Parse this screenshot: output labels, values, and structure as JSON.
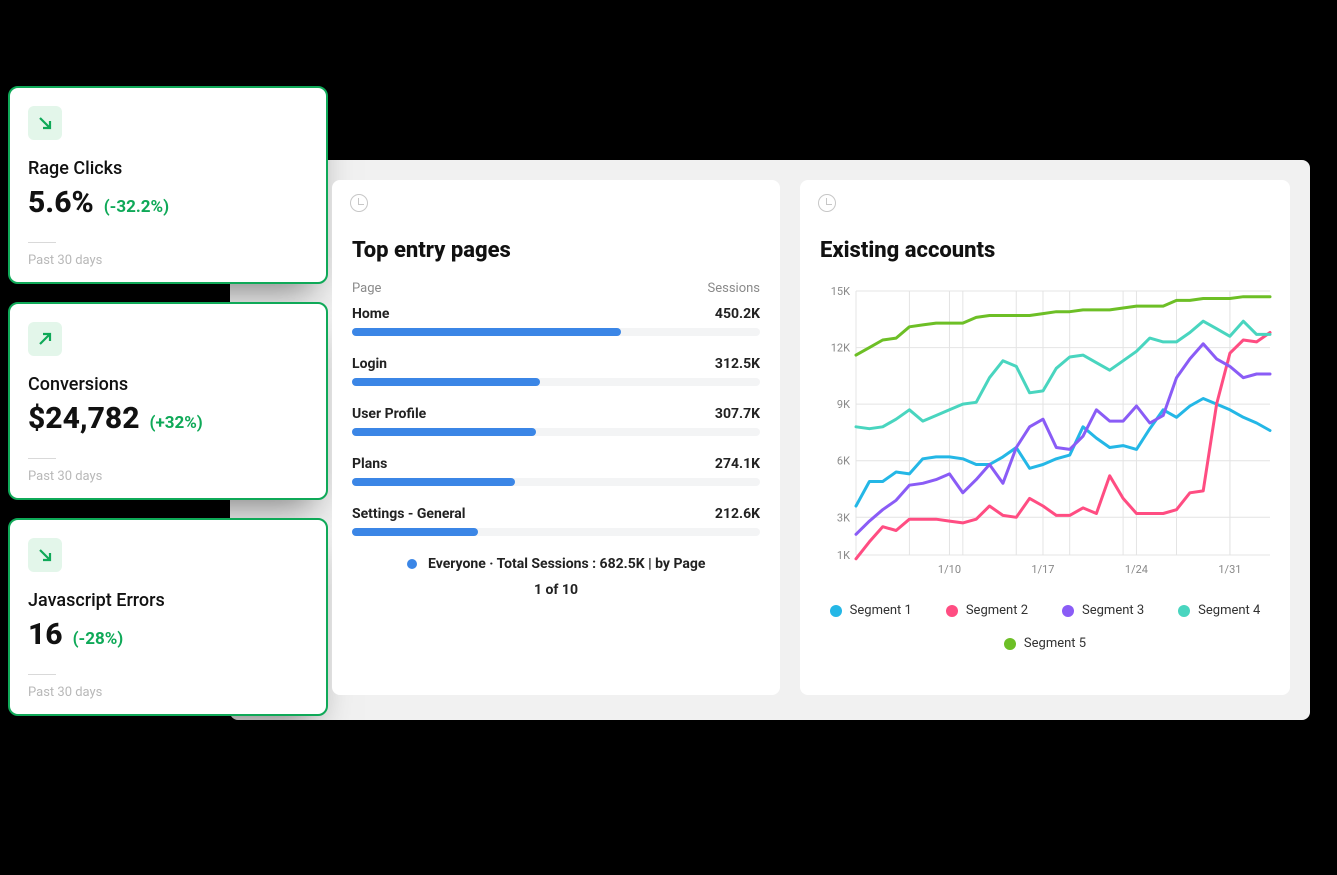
{
  "kpi": [
    {
      "title": "Rage Clicks",
      "value": "5.6%",
      "delta": "(-32.2%)",
      "trend": "down",
      "footer": "Past 30 days"
    },
    {
      "title": "Conversions",
      "value": "$24,782",
      "delta": "(+32%)",
      "trend": "up",
      "footer": "Past 30 days"
    },
    {
      "title": "Javascript Errors",
      "value": "16",
      "delta": "(-28%)",
      "trend": "down",
      "footer": "Past 30 days"
    }
  ],
  "entry": {
    "title": "Top entry pages",
    "head_left": "Page",
    "head_right": "Sessions",
    "rows": [
      {
        "name": "Home",
        "value": "450.2K",
        "pct": 66
      },
      {
        "name": "Login",
        "value": "312.5K",
        "pct": 46
      },
      {
        "name": "User Profile",
        "value": "307.7K",
        "pct": 45
      },
      {
        "name": "Plans",
        "value": "274.1K",
        "pct": 40
      },
      {
        "name": "Settings - General",
        "value": "212.6K",
        "pct": 31
      }
    ],
    "footer": "Everyone ·  Total Sessions : 682.5K | by Page",
    "paging": "1 of 10"
  },
  "accounts": {
    "title": "Existing accounts",
    "legend": [
      "Segment 1",
      "Segment 2",
      "Segment 3",
      "Segment 4",
      "Segment 5"
    ]
  },
  "chart_data": {
    "type": "line",
    "title": "Existing accounts",
    "xlabel": "",
    "ylabel": "",
    "ylim": [
      1000,
      15000
    ],
    "y_ticks": [
      1000,
      3000,
      6000,
      9000,
      12000,
      15000
    ],
    "y_tick_labels": [
      "1K",
      "3K",
      "6K",
      "9K",
      "12K",
      "15K"
    ],
    "x_ticks": [
      "1/10",
      "1/17",
      "1/24",
      "1/31"
    ],
    "categories": [
      "1/3",
      "1/4",
      "1/5",
      "1/6",
      "1/7",
      "1/8",
      "1/9",
      "1/10",
      "1/11",
      "1/12",
      "1/13",
      "1/14",
      "1/15",
      "1/16",
      "1/17",
      "1/18",
      "1/19",
      "1/20",
      "1/21",
      "1/22",
      "1/23",
      "1/24",
      "1/25",
      "1/26",
      "1/27",
      "1/28",
      "1/29",
      "1/30",
      "1/31",
      "2/1",
      "2/2",
      "2/3"
    ],
    "series": [
      {
        "name": "Segment 1",
        "color": "#24b7e6",
        "values": [
          3600,
          4900,
          4900,
          5400,
          5300,
          6100,
          6200,
          6200,
          6100,
          5800,
          5800,
          6200,
          6700,
          5600,
          5800,
          6100,
          6300,
          7800,
          7200,
          6700,
          6800,
          6600,
          7700,
          8700,
          8300,
          8900,
          9300,
          9000,
          8700,
          8300,
          8000,
          7600
        ]
      },
      {
        "name": "Segment 2",
        "color": "#ff4d82",
        "values": [
          800,
          1700,
          2500,
          2300,
          2900,
          2900,
          2900,
          2800,
          2700,
          2900,
          3600,
          3100,
          3000,
          4000,
          3600,
          3100,
          3100,
          3500,
          3200,
          5200,
          4000,
          3200,
          3200,
          3200,
          3400,
          4300,
          4400,
          9000,
          11700,
          12400,
          12300,
          12800
        ]
      },
      {
        "name": "Segment 3",
        "color": "#8a5cf6",
        "values": [
          2100,
          2800,
          3400,
          3900,
          4700,
          4800,
          5000,
          5300,
          4300,
          5000,
          5800,
          4800,
          6700,
          7800,
          8200,
          6700,
          6600,
          7300,
          8700,
          8100,
          8100,
          8900,
          8000,
          8400,
          10400,
          11400,
          12200,
          11400,
          11000,
          10400,
          10600,
          10600
        ]
      },
      {
        "name": "Segment 4",
        "color": "#49d5bf",
        "values": [
          7800,
          7700,
          7800,
          8200,
          8700,
          8100,
          8400,
          8700,
          9000,
          9100,
          10400,
          11300,
          11000,
          9600,
          9700,
          10900,
          11500,
          11600,
          11200,
          10800,
          11300,
          11800,
          12500,
          12300,
          12300,
          12800,
          13400,
          13000,
          12600,
          13400,
          12700,
          12700
        ]
      },
      {
        "name": "Segment 5",
        "color": "#6dbf26",
        "values": [
          11600,
          12000,
          12400,
          12500,
          13100,
          13200,
          13300,
          13300,
          13300,
          13600,
          13700,
          13700,
          13700,
          13700,
          13800,
          13900,
          13900,
          14000,
          14000,
          14000,
          14100,
          14200,
          14200,
          14200,
          14500,
          14500,
          14600,
          14600,
          14600,
          14700,
          14700,
          14700
        ]
      }
    ]
  }
}
